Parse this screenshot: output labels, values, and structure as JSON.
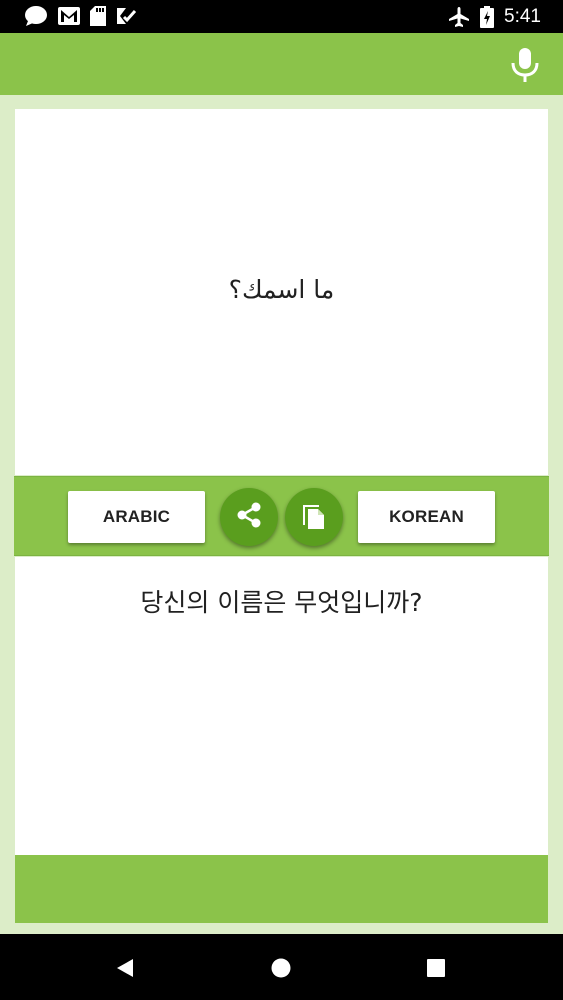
{
  "status_bar": {
    "time": "5:41",
    "left_icons": [
      "message-icon",
      "gmail-icon",
      "sd-card-icon",
      "check-icon"
    ],
    "right_icons": [
      "airplane-icon",
      "battery-icon"
    ]
  },
  "app_bar": {
    "color": "#8bc34a",
    "action_icon": "microphone-icon"
  },
  "source": {
    "text": "ما اسمك؟",
    "language": "ARABIC"
  },
  "target": {
    "text": "당신의 이름은 무엇입니까?",
    "language": "KOREAN"
  },
  "controls": {
    "share_icon": "share-icon",
    "copy_icon": "copy-icon",
    "accent": "#5a9e1e"
  },
  "nav_bar": {
    "icons": [
      "back-icon",
      "home-icon",
      "recents-icon"
    ]
  }
}
